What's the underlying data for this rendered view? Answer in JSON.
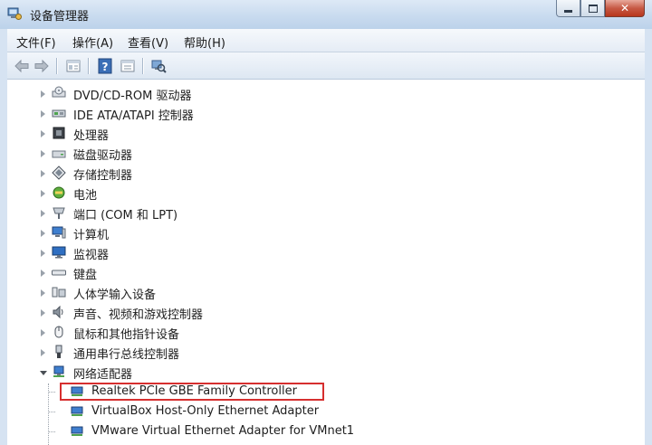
{
  "window": {
    "title": "设备管理器"
  },
  "menu": [
    "文件(F)",
    "操作(A)",
    "查看(V)",
    "帮助(H)"
  ],
  "toolbar": [
    "back-icon",
    "forward-icon",
    "properties-icon",
    "help-icon",
    "show-hidden-icon",
    "scan-hardware-icon"
  ],
  "tree": {
    "categories": [
      {
        "label": "DVD/CD-ROM 驱动器",
        "icon": "dvd-drive-icon"
      },
      {
        "label": "IDE ATA/ATAPI 控制器",
        "icon": "ide-controller-icon"
      },
      {
        "label": "处理器",
        "icon": "processor-icon"
      },
      {
        "label": "磁盘驱动器",
        "icon": "disk-drive-icon"
      },
      {
        "label": "存储控制器",
        "icon": "storage-controller-icon"
      },
      {
        "label": "电池",
        "icon": "battery-icon"
      },
      {
        "label": "端口 (COM 和 LPT)",
        "icon": "port-icon"
      },
      {
        "label": "计算机",
        "icon": "computer-icon"
      },
      {
        "label": "监视器",
        "icon": "monitor-icon"
      },
      {
        "label": "键盘",
        "icon": "keyboard-icon"
      },
      {
        "label": "人体学输入设备",
        "icon": "hid-icon"
      },
      {
        "label": "声音、视频和游戏控制器",
        "icon": "sound-icon"
      },
      {
        "label": "鼠标和其他指针设备",
        "icon": "mouse-icon"
      },
      {
        "label": "通用串行总线控制器",
        "icon": "usb-icon"
      },
      {
        "label": "网络适配器",
        "icon": "network-adapter-icon",
        "expanded": true
      }
    ],
    "network_children": [
      {
        "label": "Realtek PCIe GBE Family Controller",
        "highlighted": true
      },
      {
        "label": "VirtualBox Host-Only Ethernet Adapter"
      },
      {
        "label": "VMware Virtual Ethernet Adapter for VMnet1"
      }
    ]
  },
  "colors": {
    "highlight_border": "#d62f2f",
    "title_bar": "#c9dbef"
  }
}
